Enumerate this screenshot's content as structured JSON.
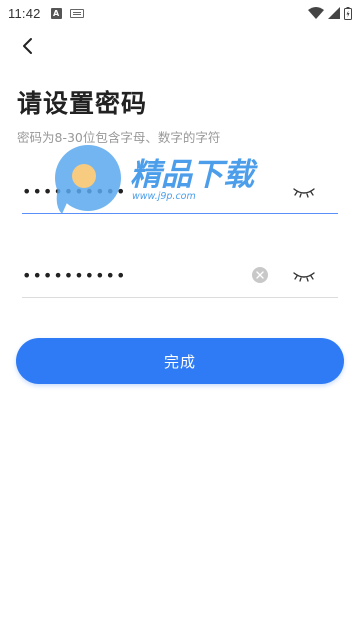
{
  "status_bar": {
    "time": "11:42",
    "a_icon_letter": "A"
  },
  "page": {
    "title": "请设置密码",
    "subtitle": "密码为8-30位包含字母、数字的字符"
  },
  "fields": {
    "password": {
      "value": "••••••••••"
    },
    "confirm_password": {
      "value": "••••••••••"
    }
  },
  "done_button": {
    "label": "完成"
  },
  "colors": {
    "accent": "#2f7bf5",
    "active_underline": "#5b8ff9",
    "inactive_underline": "#dcdcdc",
    "subtitle": "#999999"
  },
  "watermark": {
    "brand_cn": "精品下载",
    "url": "www.j9p.com"
  }
}
